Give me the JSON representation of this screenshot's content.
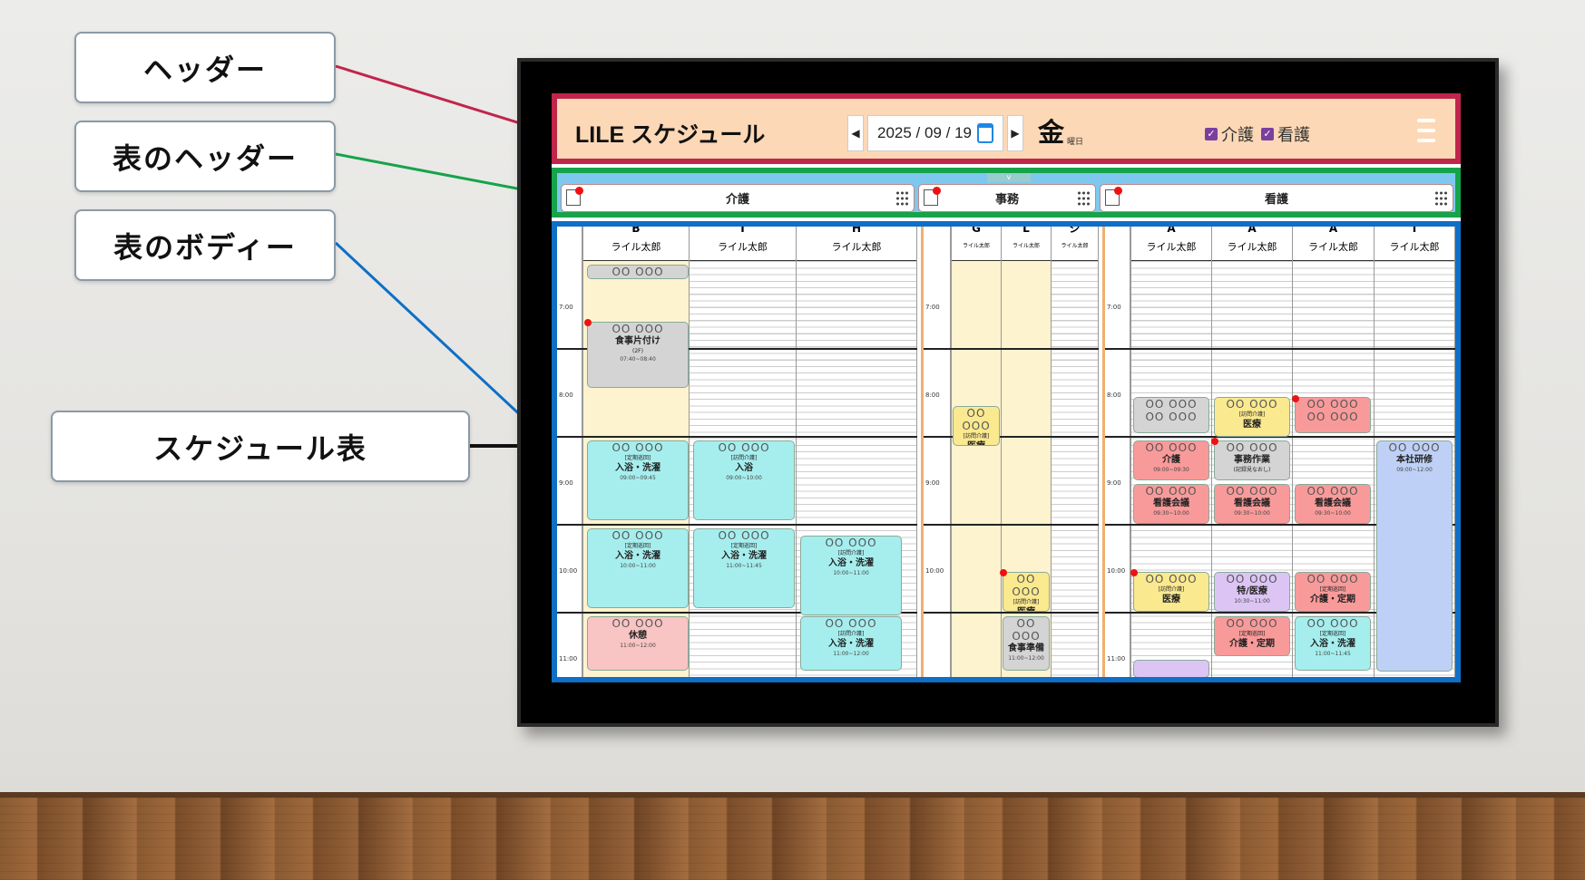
{
  "callouts": {
    "header": "ヘッダー",
    "table_header": "表のヘッダー",
    "table_body": "表のボディー",
    "schedule_table": "スケジュール表"
  },
  "app": {
    "title": "LILE スケジュール",
    "date": "2025 / 09 / 19",
    "weekday": "金",
    "weekday_suffix": "曜日"
  },
  "filters": [
    {
      "label": "介護",
      "checked": true
    },
    {
      "label": "看護",
      "checked": true
    }
  ],
  "groups": [
    {
      "name": "介護",
      "badge": "0"
    },
    {
      "name": "事務",
      "badge": "0"
    },
    {
      "name": "看護",
      "badge": "0"
    }
  ],
  "columns": [
    {
      "code": "B",
      "name": "ライル太郎"
    },
    {
      "code": "I",
      "name": "ライル太郎"
    },
    {
      "code": "H",
      "name": "ライル太郎"
    },
    {
      "code": "G",
      "name": "ライル太郎"
    },
    {
      "code": "L",
      "name": "ライル太郎"
    },
    {
      "code": "ジ",
      "name": "ライル太郎"
    },
    {
      "code": "A",
      "name": "ライル太郎"
    },
    {
      "code": "A",
      "name": "ライル太郎"
    },
    {
      "code": "A",
      "name": "ライル太郎"
    },
    {
      "code": "T",
      "name": "ライル太郎"
    }
  ],
  "times": [
    "7:00",
    "8:00",
    "9:00",
    "10:00",
    "11:00"
  ],
  "events": {
    "placeholder": "OO OOO",
    "e1": {
      "ttl": "食事片付け",
      "sub": "(2F)",
      "tm": "07:40~08:40"
    },
    "e2": {
      "tag": "[定期巡回]",
      "ttl": "入浴・洗濯",
      "tm": "09:00~09:45"
    },
    "e3": {
      "tag": "[訪問介護]",
      "ttl": "入浴",
      "tm": "09:00~10:00"
    },
    "e4": {
      "tag": "[定期巡回]",
      "ttl": "入浴・洗濯",
      "tm": "10:00~11:00"
    },
    "e5": {
      "tag": "[定期巡回]",
      "ttl": "入浴・洗濯",
      "tm": "11:00~11:45"
    },
    "e6": {
      "tag": "[訪問介護]",
      "ttl": "入浴・洗濯",
      "tm": "10:00~11:00"
    },
    "e7": {
      "ttl": "休憩",
      "tm": "11:00~12:00"
    },
    "e8": {
      "tag": "[訪問介護]",
      "ttl": "入浴・洗濯",
      "tm": "11:00~12:00"
    },
    "e9": {
      "tag": "[訪問介護]",
      "ttl": "医療"
    },
    "e10": {
      "tag": "[訪問介護]",
      "ttl": "医療"
    },
    "e11": {
      "ttl": "食事準備",
      "tm": "11:00~12:00"
    },
    "e12": {
      "tag": "[訪問介護]",
      "ttl": "医療"
    },
    "e13": {
      "ttl": "介護",
      "tm": "09:00~09:30"
    },
    "e14": {
      "ttl": "事務作業",
      "sub": "(記録見なおし)"
    },
    "e15": {
      "ttl": "看護会議",
      "tm": "09:30~10:00"
    },
    "e16": {
      "ttl": "看護会議",
      "tm": "09:30~10:00"
    },
    "e17": {
      "ttl": "看護会議",
      "tm": "09:30~10:00"
    },
    "e18": {
      "tag": "[訪問介護]",
      "ttl": "医療"
    },
    "e19": {
      "ttl": "特/医療",
      "tm": "10:30~11:00"
    },
    "e20": {
      "tag": "[定期巡回]",
      "ttl": "介護・定期"
    },
    "e21": {
      "tag": "[定期巡回]",
      "ttl": "介護・定期"
    },
    "e22": {
      "tag": "[定期巡回]",
      "ttl": "入浴・洗濯",
      "tm": "11:00~11:45"
    },
    "e23": {
      "ttl": "本社研修",
      "tm": "09:00~12:00"
    }
  },
  "colors": {
    "header_bg": "#fcd8b6",
    "header_border": "#c0254a",
    "thead_border": "#16a34a",
    "body_border": "#0f6fc6"
  }
}
